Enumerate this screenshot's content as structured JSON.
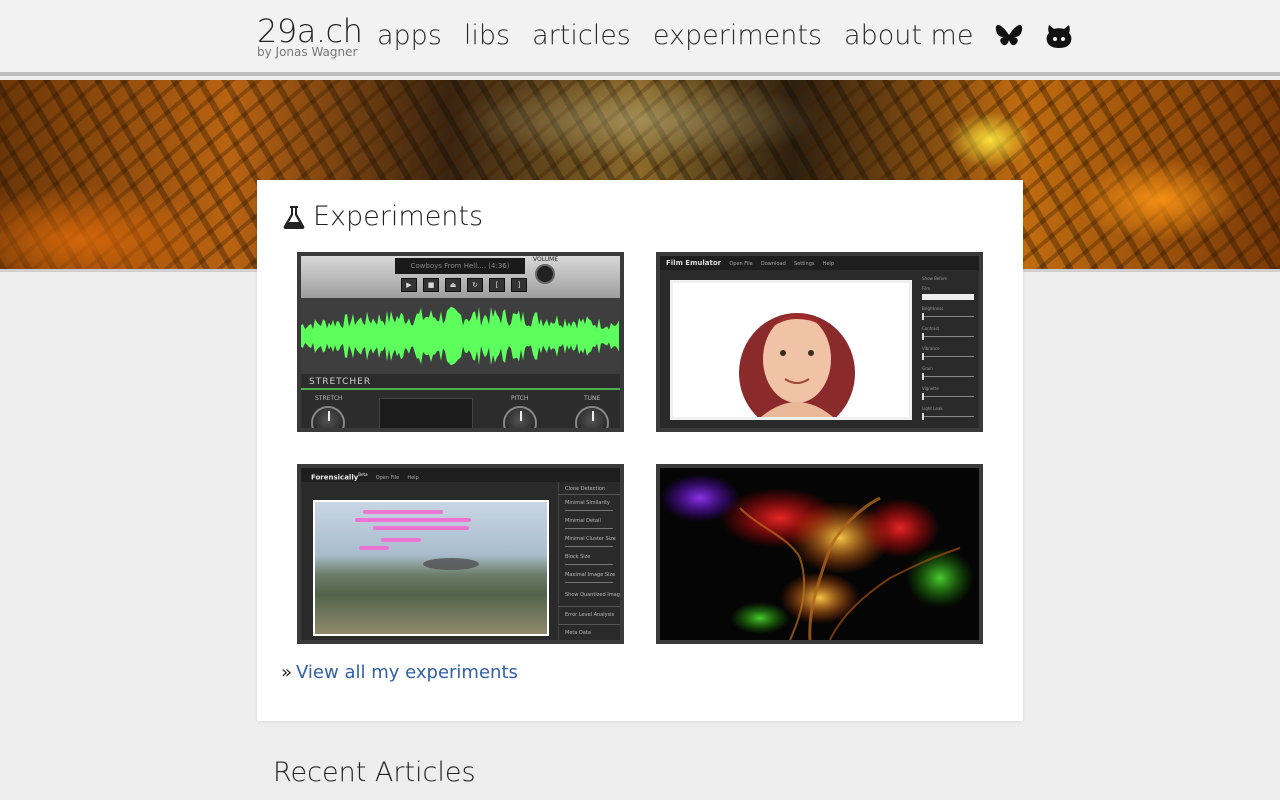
{
  "header": {
    "logo_title": "29a.ch",
    "logo_subtitle": "by Jonas Wagner",
    "nav": [
      {
        "label": "apps"
      },
      {
        "label": "libs"
      },
      {
        "label": "articles"
      },
      {
        "label": "experiments"
      },
      {
        "label": "about me"
      }
    ],
    "social_icons": [
      "bluesky-icon",
      "github-icon"
    ]
  },
  "experiments": {
    "title": "Experiments",
    "title_icon": "flask-icon",
    "items": [
      {
        "name": "stretcher",
        "display_text": "Cowboys From Hell.... (4:36)",
        "volume_label": "VOLUME",
        "brand": "STRETCHER",
        "knob_labels": [
          "STRETCH",
          "PITCH",
          "TUNE"
        ],
        "wave_color": "#5dff5d"
      },
      {
        "name": "film-emulator",
        "app_title": "Film Emulator",
        "menu": [
          "Open File",
          "Download",
          "Settings",
          "Help"
        ],
        "panel_labels": [
          "Show Before",
          "Film",
          "Brightness",
          "Contrast",
          "Vibrance",
          "Grain",
          "Vignette",
          "Light Leak"
        ]
      },
      {
        "name": "forensically",
        "app_title": "Forensically",
        "app_badge": "Beta",
        "menu": [
          "Open File",
          "Help"
        ],
        "panel_labels": [
          "Clone Detection",
          "Minimal Similarity",
          "Minimal Detail",
          "Minimal Cluster Size",
          "Block Size",
          "Maximal Image Size",
          "Show Quantized Image",
          "Error Level Analysis",
          "Meta Data"
        ]
      },
      {
        "name": "fractal"
      }
    ],
    "view_all_prefix": "»",
    "view_all_label": "View all my experiments"
  },
  "recent_articles": {
    "title": "Recent Articles"
  },
  "colors": {
    "link": "#3060a8",
    "page_bg": "#ededed",
    "card_bg": "#ffffff"
  }
}
